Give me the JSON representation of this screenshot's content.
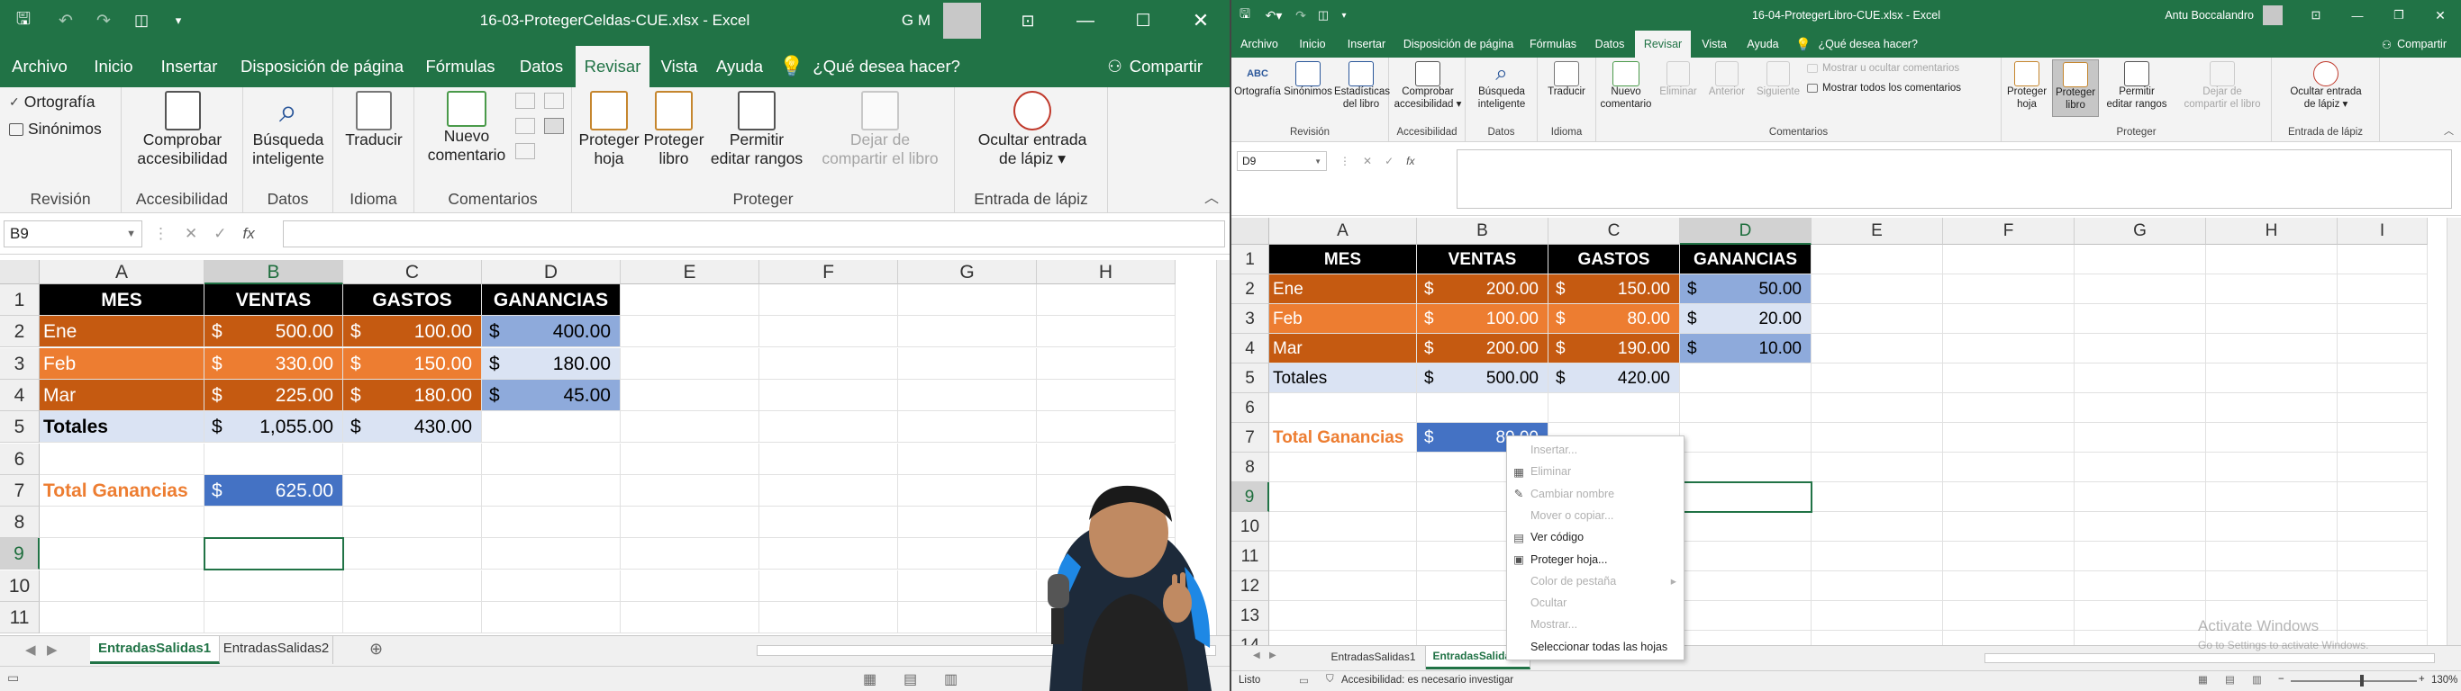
{
  "left": {
    "title": "16-03-ProtegerCeldas-CUE.xlsx  -  Excel",
    "user_initials": "G M",
    "qat_icons": [
      "save-icon",
      "undo-icon",
      "redo-icon",
      "camera-icon",
      "customize-icon"
    ],
    "window_controls": [
      "ribbon-display-icon",
      "minimize-icon",
      "maximize-icon",
      "close-icon"
    ],
    "menu_tabs": [
      "Archivo",
      "Inicio",
      "Insertar",
      "Disposición de página",
      "Fórmulas",
      "Datos",
      "Revisar",
      "Vista",
      "Ayuda"
    ],
    "active_tab": "Revisar",
    "tell_me": "¿Qué desea hacer?",
    "share": "Compartir",
    "ribbon": {
      "groups": [
        "Revisión",
        "Accesibilidad",
        "Datos",
        "Idioma",
        "Comentarios",
        "Proteger",
        "Entrada de lápiz"
      ],
      "ortografia": "Ortografía",
      "sinonimos": "Sinónimos",
      "accesibilidad": [
        "Comprobar",
        "accesibilidad"
      ],
      "busqueda": [
        "Búsqueda",
        "inteligente"
      ],
      "traducir": "Traducir",
      "nuevo_comentario": [
        "Nuevo",
        "comentario"
      ],
      "proteger_hoja": [
        "Proteger",
        "hoja"
      ],
      "proteger_libro": [
        "Proteger",
        "libro"
      ],
      "permitir": [
        "Permitir",
        "editar rangos"
      ],
      "dejar": [
        "Dejar de",
        "compartir el libro"
      ],
      "ocultar": [
        "Ocultar entrada",
        "de lápiz ▾"
      ]
    },
    "namebox": "B9",
    "fx": "fx",
    "columns": [
      "A",
      "B",
      "C",
      "D",
      "E",
      "F",
      "G",
      "H"
    ],
    "rows": [
      "1",
      "2",
      "3",
      "4",
      "5",
      "6",
      "7",
      "8",
      "9",
      "10",
      "11"
    ],
    "selected_col": "B",
    "selected_row": "9",
    "headers": [
      "MES",
      "VENTAS",
      "GASTOS",
      "GANANCIAS"
    ],
    "data_rows": [
      {
        "mes": "Ene",
        "ventas": "500.00",
        "gastos": "100.00",
        "ganancias": "400.00"
      },
      {
        "mes": "Feb",
        "ventas": "330.00",
        "gastos": "150.00",
        "ganancias": "180.00"
      },
      {
        "mes": "Mar",
        "ventas": "225.00",
        "gastos": "180.00",
        "ganancias": "45.00"
      }
    ],
    "totales_label": "Totales",
    "totales_ventas": "1,055.00",
    "totales_gastos": "430.00",
    "total_ganancias_label": "Total Ganancias",
    "total_ganancias": "625.00",
    "currency": "$",
    "sheets": [
      "EntradasSalidas1",
      "EntradasSalidas2"
    ],
    "active_sheet": "EntradasSalidas1"
  },
  "right": {
    "title": "16-04-ProtegerLibro-CUE.xlsx  -  Excel",
    "user": "Antu Boccalandro",
    "menu_tabs": [
      "Archivo",
      "Inicio",
      "Insertar",
      "Disposición de página",
      "Fórmulas",
      "Datos",
      "Revisar",
      "Vista",
      "Ayuda"
    ],
    "active_tab": "Revisar",
    "tell_me": "¿Qué desea hacer?",
    "share": "Compartir",
    "ribbon": {
      "groups": [
        "Revisión",
        "Accesibilidad",
        "Datos",
        "Idioma",
        "Comentarios",
        "Proteger",
        "Entrada de lápiz"
      ],
      "ortografia": "Ortografía",
      "sinonimos": "Sinónimos",
      "estadisticas": [
        "Estadísticas",
        "del libro"
      ],
      "accesibilidad": [
        "Comprobar",
        "accesibilidad ▾"
      ],
      "busqueda": [
        "Búsqueda",
        "inteligente"
      ],
      "traducir": "Traducir",
      "nuevo_comentario": [
        "Nuevo",
        "comentario"
      ],
      "eliminar": "Eliminar",
      "anterior": "Anterior",
      "siguiente": "Siguiente",
      "mostrar_ocultar": "Mostrar u ocultar comentarios",
      "mostrar_todos": "Mostrar todos los comentarios",
      "proteger_hoja": [
        "Proteger",
        "hoja"
      ],
      "proteger_libro": [
        "Proteger",
        "libro"
      ],
      "permitir": [
        "Permitir",
        "editar rangos"
      ],
      "dejar": [
        "Dejar de",
        "compartir el libro"
      ],
      "ocultar": [
        "Ocultar entrada",
        "de lápiz ▾"
      ]
    },
    "namebox": "D9",
    "fx": "fx",
    "columns": [
      "A",
      "B",
      "C",
      "D",
      "E",
      "F",
      "G",
      "H",
      "I"
    ],
    "rows": [
      "1",
      "2",
      "3",
      "4",
      "5",
      "6",
      "7",
      "8",
      "9",
      "10",
      "11",
      "12",
      "13",
      "14"
    ],
    "selected_col": "D",
    "selected_row": "9",
    "headers": [
      "MES",
      "VENTAS",
      "GASTOS",
      "GANANCIAS"
    ],
    "data_rows": [
      {
        "mes": "Ene",
        "ventas": "200.00",
        "gastos": "150.00",
        "ganancias": "50.00"
      },
      {
        "mes": "Feb",
        "ventas": "100.00",
        "gastos": "80.00",
        "ganancias": "20.00"
      },
      {
        "mes": "Mar",
        "ventas": "200.00",
        "gastos": "190.00",
        "ganancias": "10.00"
      }
    ],
    "totales_label": "Totales",
    "totales_ventas": "500.00",
    "totales_gastos": "420.00",
    "total_ganancias_label": "Total Ganancias",
    "total_ganancias": "80.00",
    "currency": "$",
    "context_menu": [
      {
        "label": "Insertar...",
        "disabled": true,
        "icon": ""
      },
      {
        "label": "Eliminar",
        "disabled": true,
        "icon": "delete-sheet-icon"
      },
      {
        "label": "Cambiar nombre",
        "disabled": true,
        "icon": "rename-icon"
      },
      {
        "label": "Mover o copiar...",
        "disabled": true,
        "icon": ""
      },
      {
        "label": "Ver código",
        "disabled": false,
        "icon": "view-code-icon"
      },
      {
        "label": "Proteger hoja...",
        "disabled": false,
        "icon": "protect-sheet-icon"
      },
      {
        "label": "Color de pestaña",
        "disabled": true,
        "icon": "",
        "submenu": true
      },
      {
        "label": "Ocultar",
        "disabled": true,
        "icon": ""
      },
      {
        "label": "Mostrar...",
        "disabled": true,
        "icon": ""
      },
      {
        "label": "Seleccionar todas las hojas",
        "disabled": false,
        "icon": ""
      }
    ],
    "sheets": [
      "EntradasSalidas1",
      "EntradasSalidas2"
    ],
    "active_sheet": "EntradasSalidas2",
    "status_ready": "Listo",
    "status_accessibility": "Accesibilidad: es necesario investigar",
    "zoom": "130%",
    "watermark_line1": "Activate Windows",
    "watermark_line2": "Go to Settings to activate Windows."
  }
}
